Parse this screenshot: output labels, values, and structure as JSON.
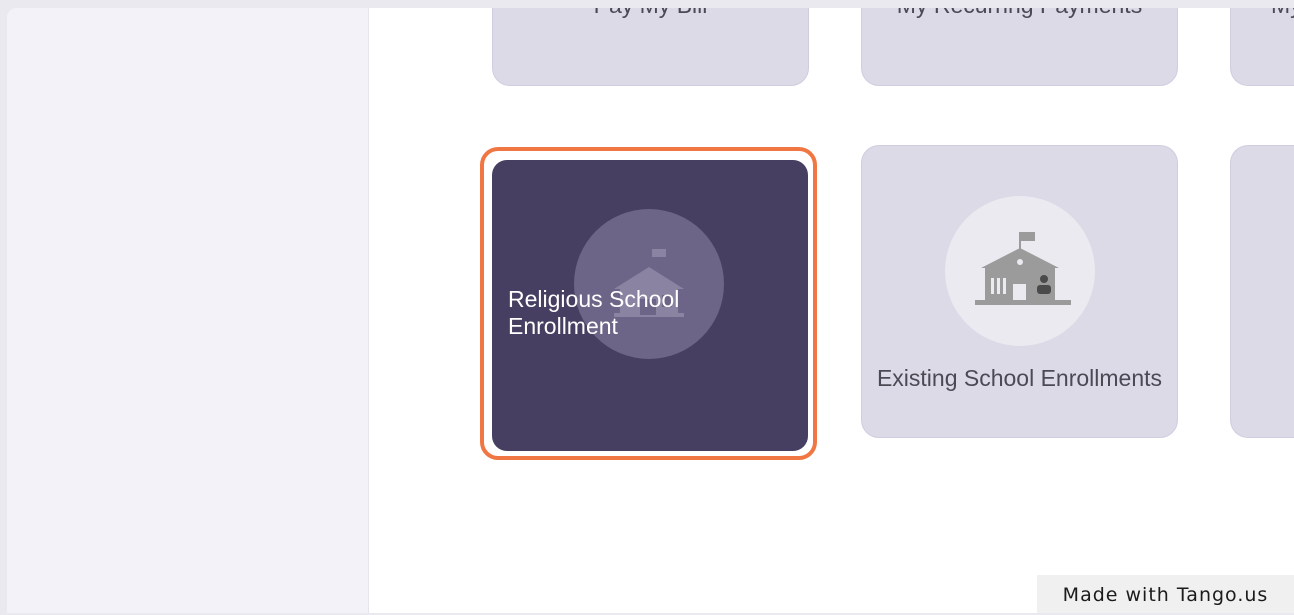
{
  "tiles_row1": [
    {
      "label": "Pay My Bill"
    },
    {
      "label": "My Recurring Payments"
    },
    {
      "label": "My"
    }
  ],
  "tiles_row2": [
    {
      "label": "Religious School Enrollment",
      "icon": "school-icon",
      "selected": true
    },
    {
      "label": "Existing School Enrollments",
      "icon": "school-enrollment-icon"
    }
  ],
  "watermark": "Made with Tango.us",
  "colors": {
    "selected_tile": "#463f61",
    "tile": "#dcdae6",
    "highlight_ring": "#f07744",
    "sidebar": "#f3f2f9"
  }
}
